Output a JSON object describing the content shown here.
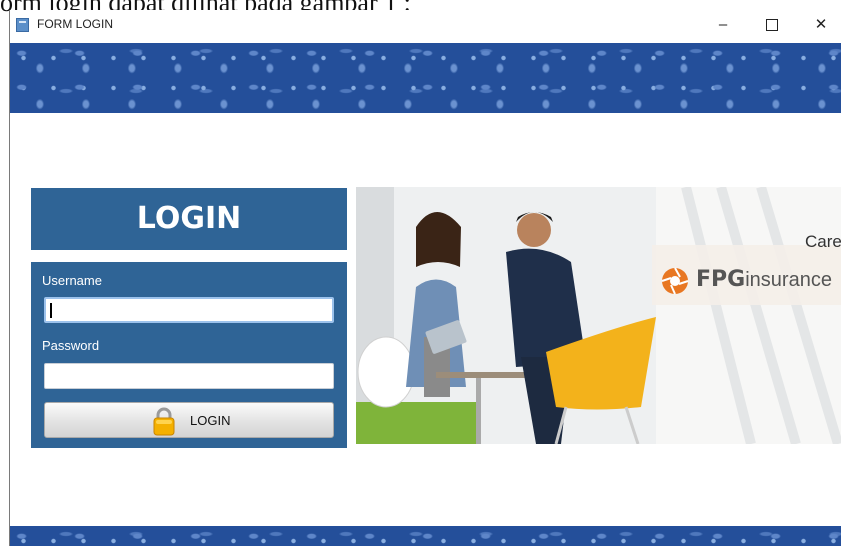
{
  "caption": "orm login dapat dilihat pada gambar 1 :",
  "window": {
    "title": "FORM LOGIN",
    "minimize": "–",
    "close": "✕"
  },
  "login": {
    "heading": "LOGIN",
    "username_label": "Username",
    "username_value": "",
    "password_label": "Password",
    "password_value": "",
    "button_label": "LOGIN",
    "button_icon": "padlock-icon"
  },
  "banner_photo": {
    "tagline": "Care",
    "brand_bold": "FPG",
    "brand_rest": "insurance",
    "brand_color": "#e87722"
  },
  "colors": {
    "panel": "#2f6496",
    "pattern": "#244f9a"
  }
}
